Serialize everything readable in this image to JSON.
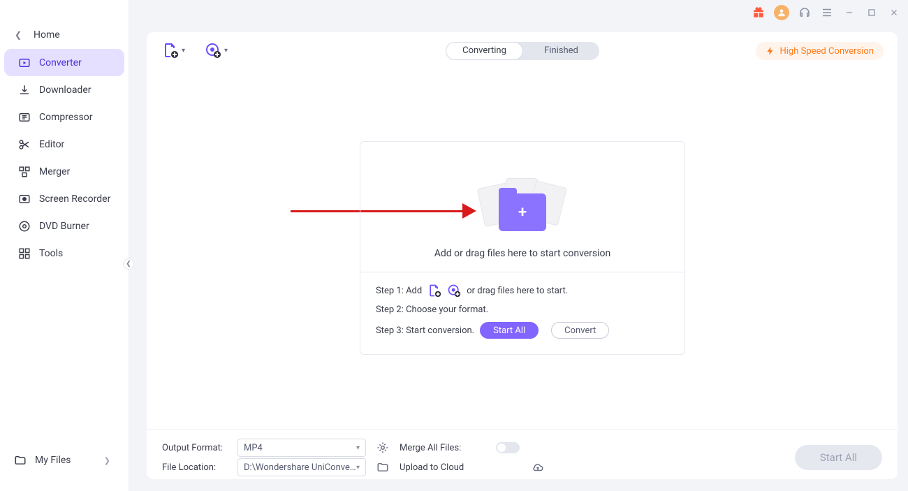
{
  "sidebar": {
    "home": "Home",
    "items": [
      {
        "label": "Converter"
      },
      {
        "label": "Downloader"
      },
      {
        "label": "Compressor"
      },
      {
        "label": "Editor"
      },
      {
        "label": "Merger"
      },
      {
        "label": "Screen Recorder"
      },
      {
        "label": "DVD Burner"
      },
      {
        "label": "Tools"
      }
    ],
    "myfiles": "My Files"
  },
  "toolbar": {
    "tab_converting": "Converting",
    "tab_finished": "Finished",
    "high_speed": "High Speed Conversion"
  },
  "dropzone": {
    "msg": "Add or drag files here to start conversion",
    "step1_pre": "Step 1: Add",
    "step1_post": "or drag files here to start.",
    "step2": "Step 2: Choose your format.",
    "step3": "Step 3: Start conversion.",
    "start_all_btn": "Start All",
    "convert_btn": "Convert"
  },
  "bottom": {
    "output_format_label": "Output Format:",
    "output_format_value": "MP4",
    "file_location_label": "File Location:",
    "file_location_value": "D:\\Wondershare UniConverter ",
    "merge_label": "Merge All Files:",
    "upload_label": "Upload to Cloud",
    "start_all": "Start All"
  }
}
